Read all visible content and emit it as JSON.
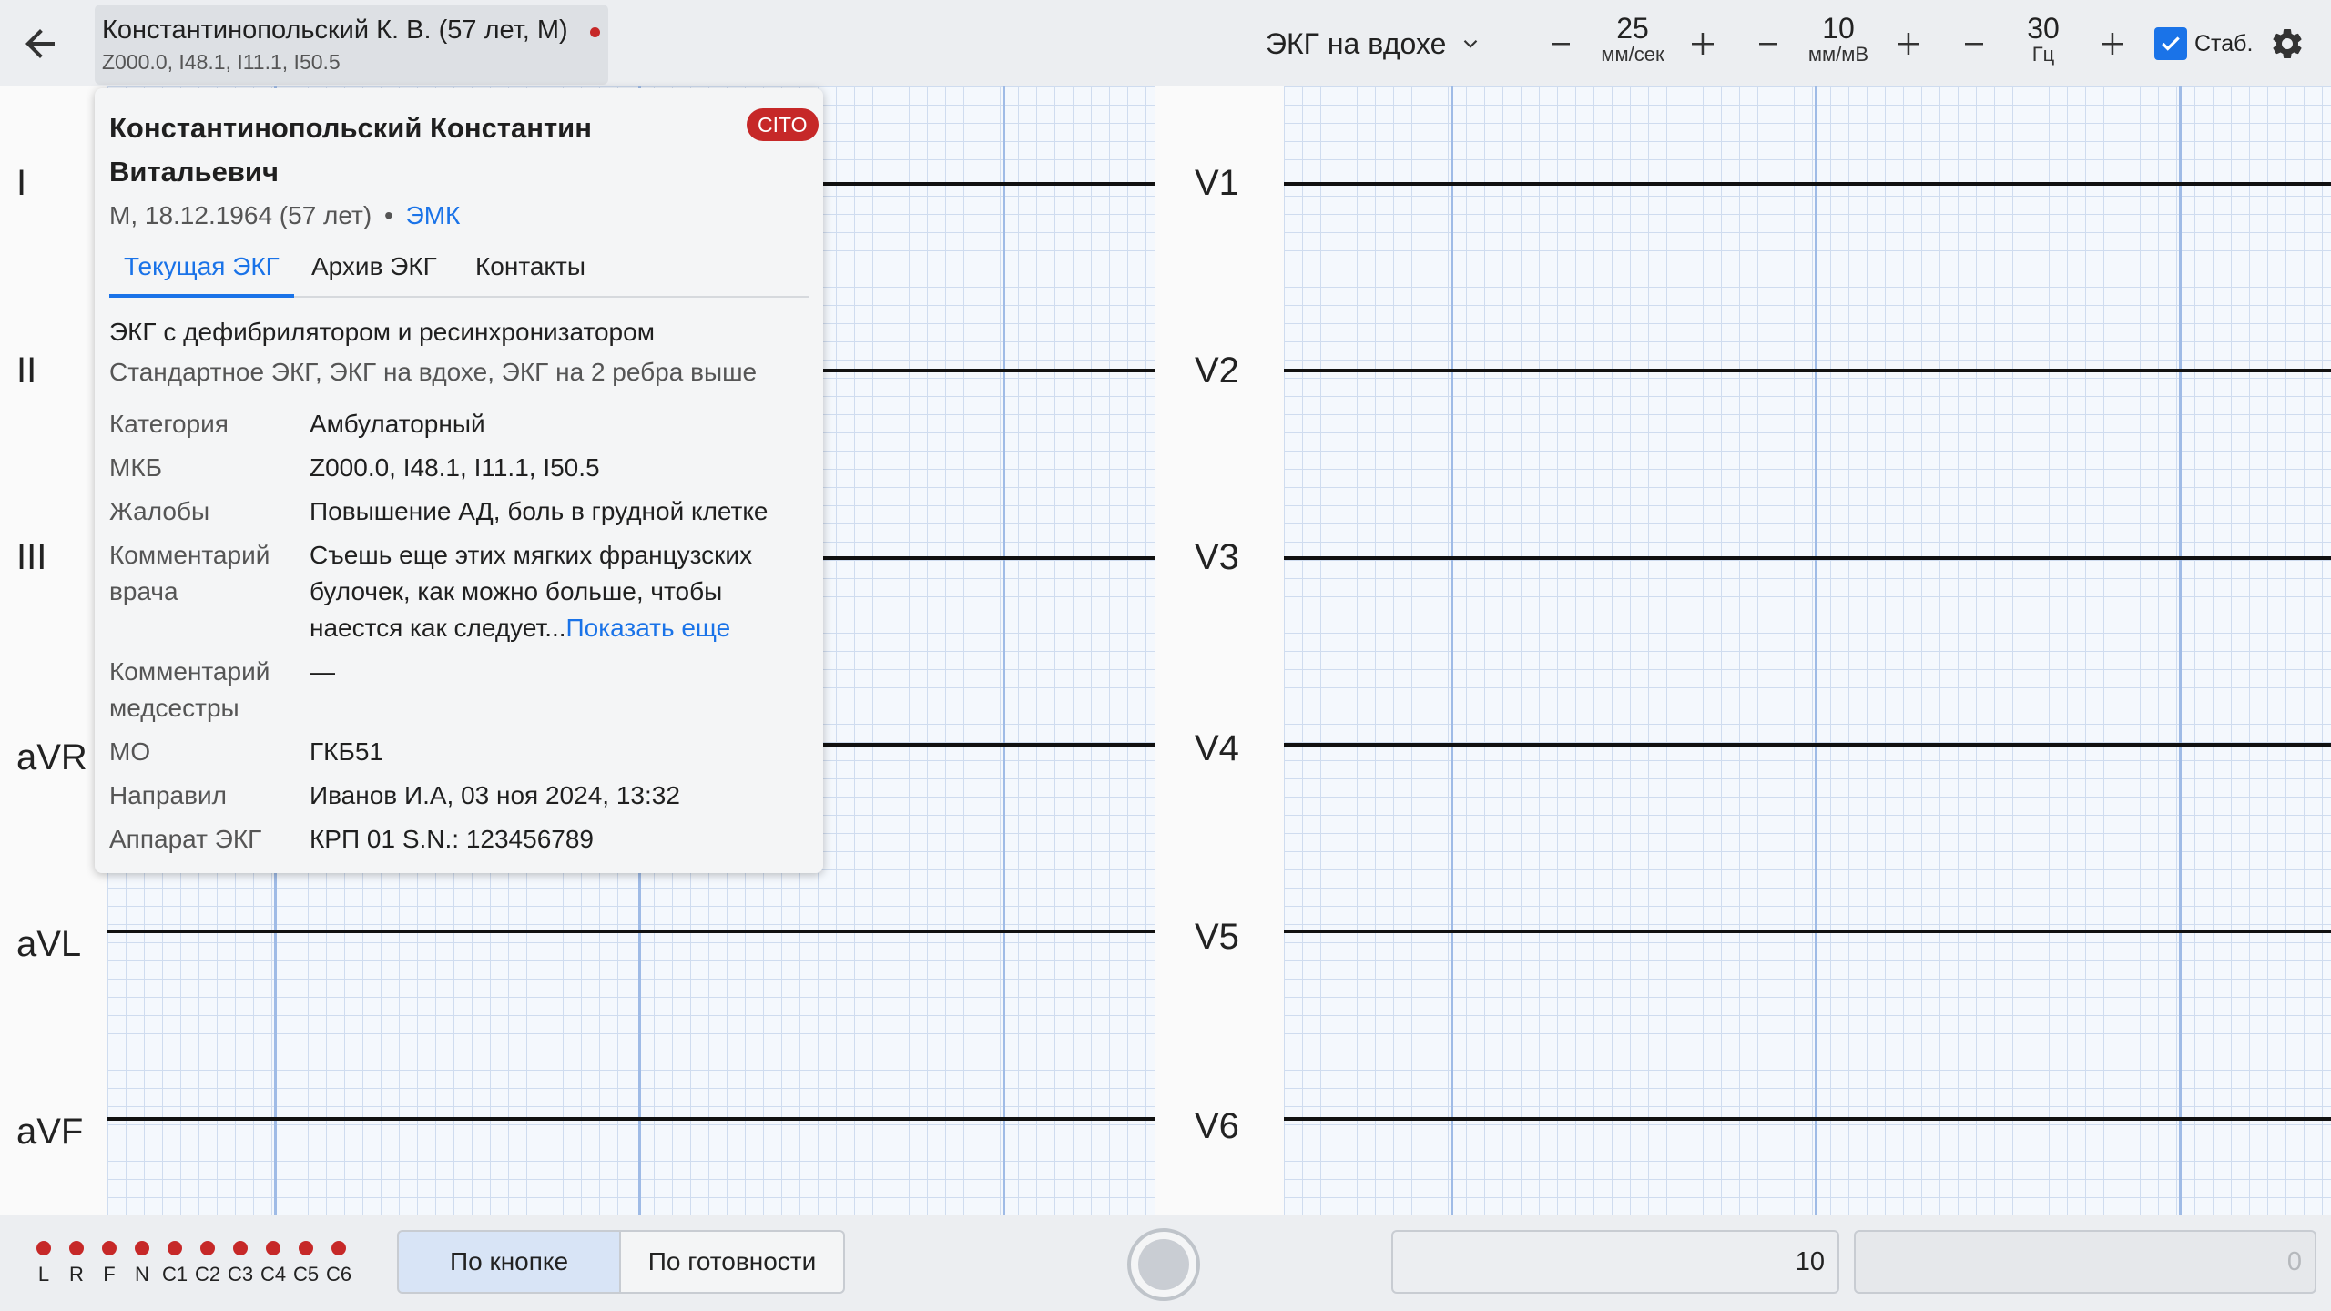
{
  "header": {
    "patient_short": "Константинопольский К. В. (57 лет, М)",
    "patient_codes": "Z000.0, I48.1, I11.1, I50.5",
    "mode": "ЭКГ на вдохе",
    "speed": {
      "value": "25",
      "unit": "мм/сек"
    },
    "gain": {
      "value": "10",
      "unit": "мм/мВ"
    },
    "filter": {
      "value": "30",
      "unit": "Гц"
    },
    "stab_label": "Стаб.",
    "stab_checked": true,
    "icons": {
      "back": "arrow-left-icon",
      "settings": "gear-icon",
      "mode": "chevron-down-icon"
    }
  },
  "leads": {
    "left": [
      "I",
      "II",
      "III",
      "aVR",
      "aVL",
      "aVF"
    ],
    "right": [
      "V1",
      "V2",
      "V3",
      "V4",
      "V5",
      "V6"
    ]
  },
  "card": {
    "full_name": "Константинопольский Константин Витальевич",
    "badge": "CITO",
    "meta": "М, 18.12.1964 (57 лет)",
    "meta_sep": "•",
    "emk_link": "ЭМК",
    "tabs": [
      "Текущая ЭКГ",
      "Архив ЭКГ",
      "Контакты"
    ],
    "active_tab": "Текущая ЭКГ",
    "ekg_type": "ЭКГ с дефибрилятором и ресинхронизатором",
    "ekg_subtypes": "Стандартное ЭКГ, ЭКГ на вдохе, ЭКГ на 2 ребра выше",
    "fields": [
      {
        "key": "Категория",
        "value": "Амбулаторный"
      },
      {
        "key": "МКБ",
        "value": "Z000.0, I48.1, I11.1, I50.5"
      },
      {
        "key": "Жалобы",
        "value": "Повышение АД, боль в грудной клетке"
      },
      {
        "key": "Комментарий врача",
        "value": "Съешь еще этих мягких французских булочек, как можно больше, чтобы наестся как следует...",
        "more": "Показать еще"
      },
      {
        "key": "Комментарий медсестры",
        "value": "—"
      },
      {
        "key": "МО",
        "value": "ГКБ51"
      },
      {
        "key": "Направил",
        "value": "Иванов И.А, 03 ноя 2024, 13:32"
      },
      {
        "key": "Аппарат ЭКГ",
        "value": "КРП 01 S.N.: 123456789"
      }
    ]
  },
  "bottom": {
    "electrodes": [
      "L",
      "R",
      "F",
      "N",
      "C1",
      "C2",
      "C3",
      "C4",
      "C5",
      "C6"
    ],
    "electrode_color": "#c62828",
    "trigger_options": [
      "По кнопке",
      "По готовности"
    ],
    "selected_trigger": "По кнопке",
    "input_value": "10",
    "counter_value": "0"
  },
  "colors": {
    "accent": "#1a73e8",
    "alert": "#c62828"
  }
}
